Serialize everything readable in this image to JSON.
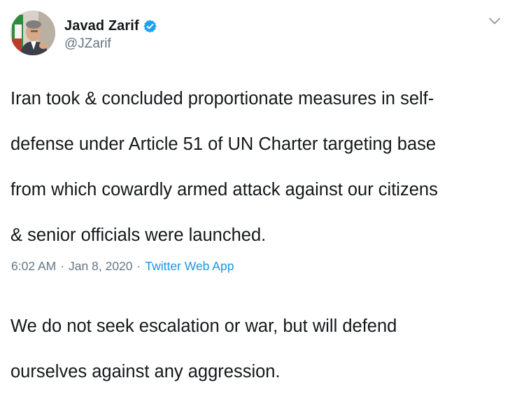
{
  "author": {
    "display_name": "Javad Zarif",
    "handle": "@JZarif",
    "verified": true
  },
  "tweet": {
    "lines": [
      "Iran took & concluded proportionate measures in self-",
      "defense under Article 51 of UN Charter targeting base",
      "from which cowardly armed attack against our citizens",
      "& senior officials were launched.",
      "",
      "We do not seek escalation or war, but will defend",
      "ourselves against any aggression."
    ]
  },
  "meta": {
    "time": "6:02 AM",
    "separator": "·",
    "date": "Jan 8, 2020",
    "source": "Twitter Web App"
  },
  "icons": {
    "verified": "verified-badge-icon",
    "menu": "chevron-down-icon"
  },
  "colors": {
    "text": "#14171a",
    "secondary": "#657786",
    "link": "#1b95e0",
    "verified": "#1da1f2"
  }
}
